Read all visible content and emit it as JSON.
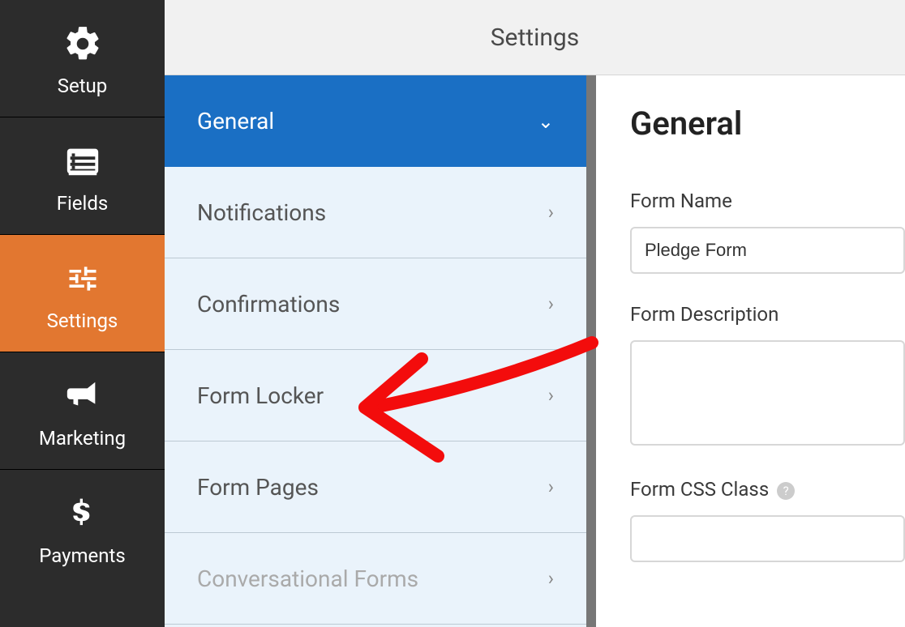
{
  "header": {
    "title": "Settings"
  },
  "sidebar": {
    "items": [
      {
        "label": "Setup"
      },
      {
        "label": "Fields"
      },
      {
        "label": "Settings"
      },
      {
        "label": "Marketing"
      },
      {
        "label": "Payments"
      }
    ]
  },
  "panel": {
    "items": [
      {
        "label": "General"
      },
      {
        "label": "Notifications"
      },
      {
        "label": "Confirmations"
      },
      {
        "label": "Form Locker"
      },
      {
        "label": "Form Pages"
      },
      {
        "label": "Conversational Forms"
      }
    ]
  },
  "form": {
    "heading": "General",
    "name_label": "Form Name",
    "name_value": "Pledge Form",
    "description_label": "Form Description",
    "description_value": "",
    "css_label": "Form CSS Class"
  }
}
